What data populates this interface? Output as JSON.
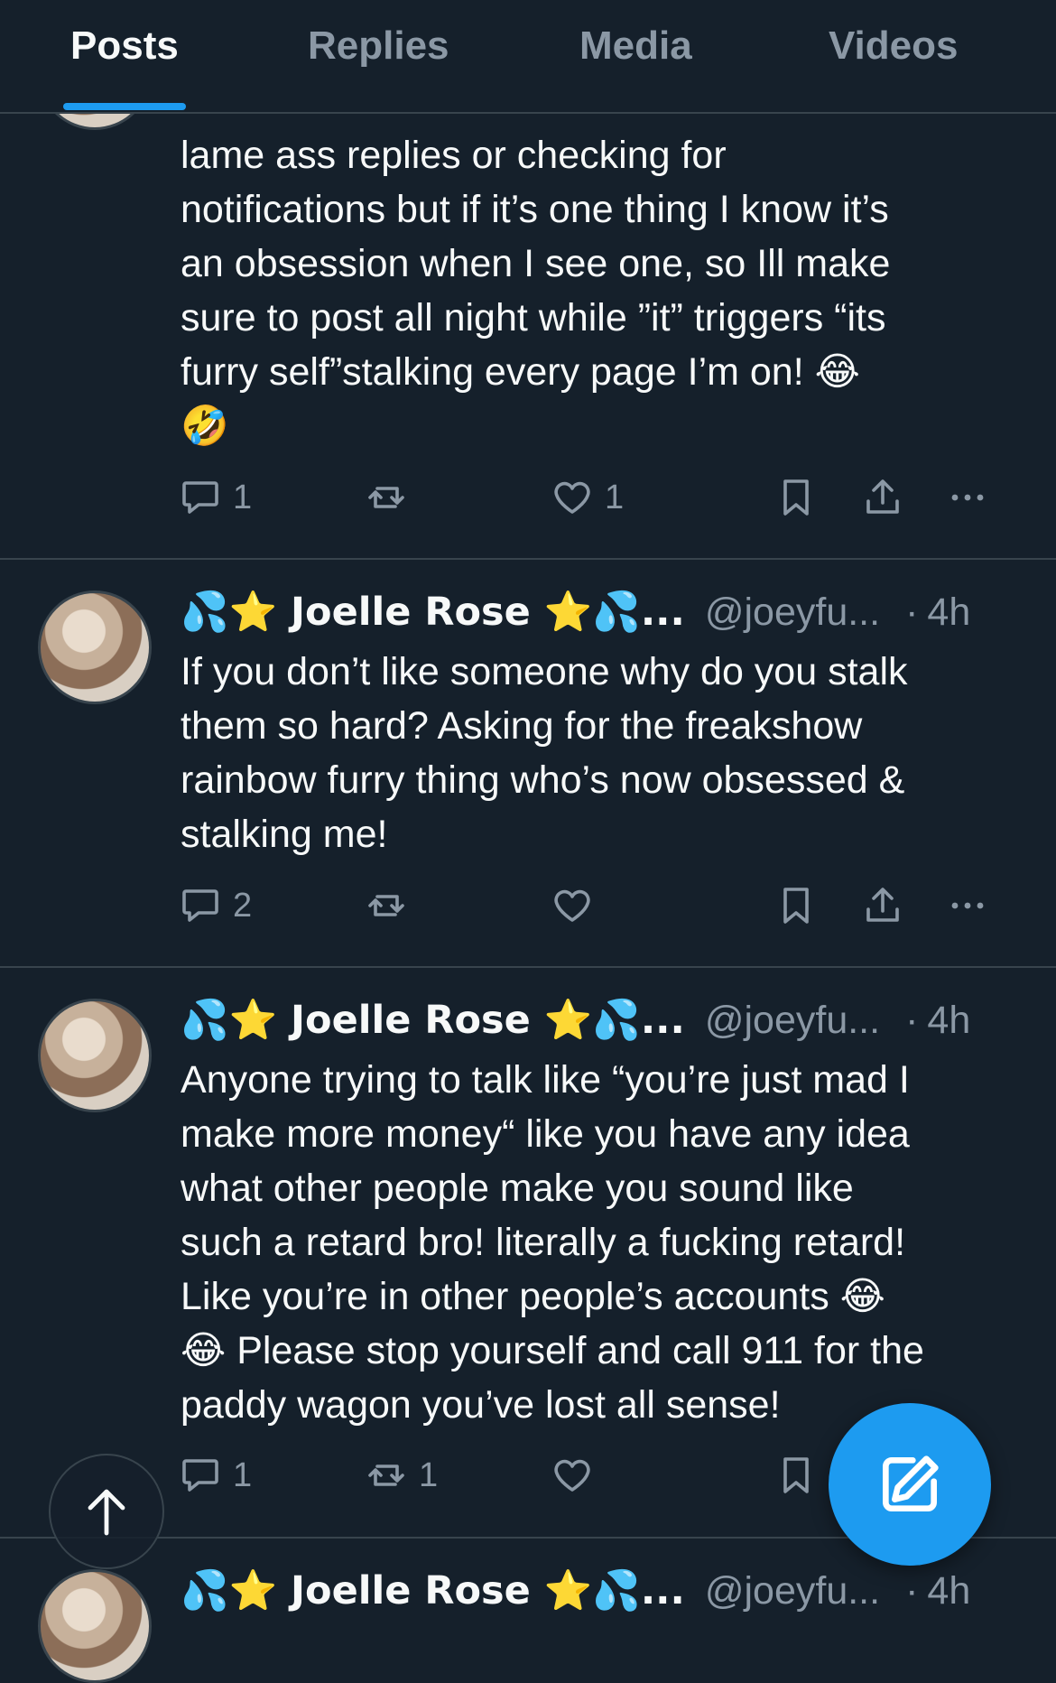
{
  "tabs": [
    {
      "label": "Posts",
      "active": true
    },
    {
      "label": "Replies",
      "active": false
    },
    {
      "label": "Media",
      "active": false
    },
    {
      "label": "Videos",
      "active": false
    }
  ],
  "colors": {
    "accent": "#1d9bf0",
    "background": "#15202b",
    "muted": "#8b98a5",
    "divider": "#38444d"
  },
  "posts": [
    {
      "text_lines": [
        "lame ass replies or checking for",
        "notifications but if it’s one thing I know it’s",
        "an obsession when I see one, so Ill make",
        "sure to post all night while ”it” triggers “its",
        "furry self”stalking every page I’m on! 😂",
        "🤣"
      ],
      "replies": "1",
      "reposts": "",
      "likes": "1"
    },
    {
      "display_name": "💦⭐ Joelle Rose ⭐💦...",
      "handle": "@joeyfu...",
      "dot": "·",
      "time": "4h",
      "text_lines": [
        "If you don’t like someone why do you stalk",
        "them so hard? Asking for the freakshow",
        "rainbow furry thing who’s now obsessed &",
        "stalking me!"
      ],
      "replies": "2",
      "reposts": "",
      "likes": ""
    },
    {
      "display_name": "💦⭐ Joelle Rose ⭐💦...",
      "handle": "@joeyfu...",
      "dot": "·",
      "time": "4h",
      "text_lines": [
        "Anyone trying to talk like “you’re just mad I",
        "make more money“ like you have any idea",
        "what other people make you sound like",
        "such a retard bro! literally a fucking retard!",
        "Like you’re in other people’s accounts 😂",
        "😂 Please stop yourself and call 911 for the",
        "paddy wagon you’ve lost all sense!"
      ],
      "replies": "1",
      "reposts": "1",
      "likes": ""
    },
    {
      "display_name": "💦⭐ Joelle Rose ⭐💦...",
      "handle": "@joeyfu...",
      "dot": "·",
      "time": "4h"
    }
  ],
  "icons": {
    "reply": "reply-icon",
    "repost": "repost-icon",
    "like": "heart-icon",
    "bookmark": "bookmark-icon",
    "share": "share-icon",
    "more": "more-icon",
    "compose": "compose-icon",
    "scroll_top": "arrow-up-icon"
  }
}
